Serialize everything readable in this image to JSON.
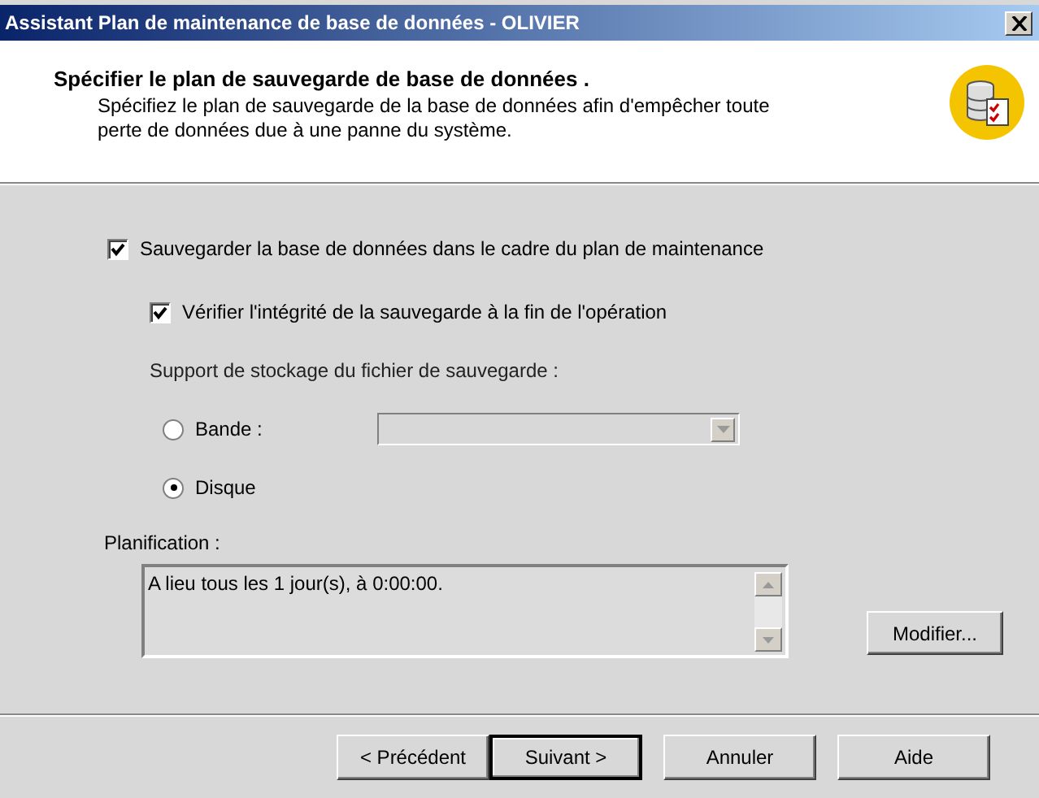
{
  "window": {
    "title": "Assistant Plan de maintenance de base de données - OLIVIER"
  },
  "header": {
    "title": "Spécifier le plan de sauvegarde de base de données .",
    "description": "Spécifiez le plan de sauvegarde de la base de données afin d'empêcher toute perte de données due à une panne du système."
  },
  "options": [
    {
      "kind": "checkbox",
      "label": "Sauvegarder la base de données dans le cadre du plan de maintenance",
      "checked": true,
      "children": [
        {
          "kind": "checkbox",
          "label": "Vérifier l'intégrité de la sauvegarde à la fin de l'opération",
          "checked": true
        }
      ]
    }
  ],
  "storage": {
    "label": "Support de stockage du fichier de sauvegarde :",
    "choices": [
      {
        "label": "Bande :",
        "selected": false,
        "has_dropdown": true,
        "dropdown_disabled": true
      },
      {
        "label": "Disque",
        "selected": true,
        "has_dropdown": false
      }
    ]
  },
  "schedule": {
    "label": "Planification :",
    "value": "A lieu tous les 1 jour(s), à 0:00:00.",
    "button": "Modifier..."
  },
  "buttons": [
    {
      "label": "< Précédent",
      "default": false
    },
    {
      "label": "Suivant >",
      "default": true
    },
    {
      "label": "Annuler",
      "default": false
    },
    {
      "label": "Aide",
      "default": false
    }
  ]
}
